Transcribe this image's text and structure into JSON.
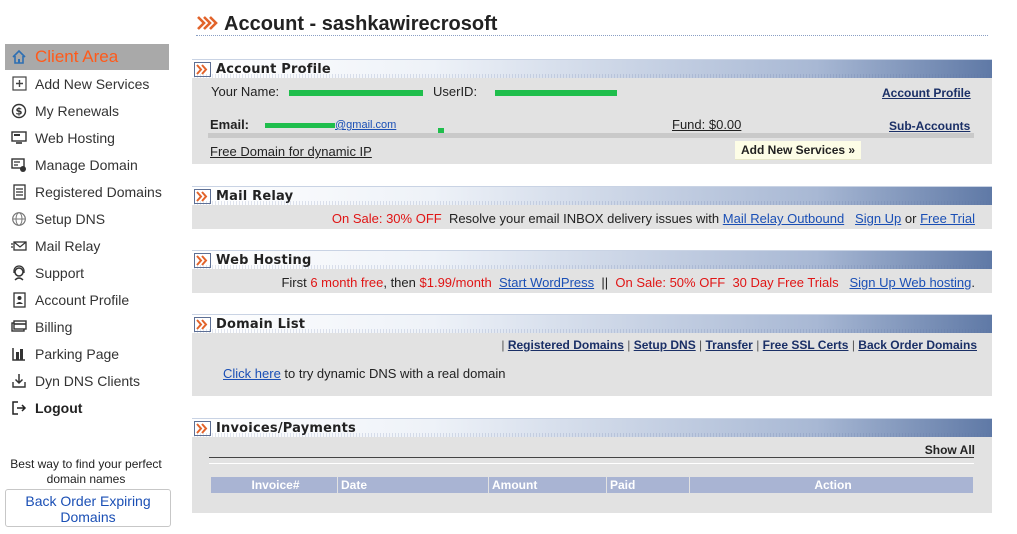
{
  "page": {
    "title": "Account - sashkawirecrosoft"
  },
  "sidebar": {
    "items": [
      {
        "label": "Client Area",
        "icon": "home-icon"
      },
      {
        "label": "Add New Services",
        "icon": "plus-box-icon"
      },
      {
        "label": "My Renewals",
        "icon": "dollar-circle-icon"
      },
      {
        "label": "Web Hosting",
        "icon": "server-icon"
      },
      {
        "label": "Manage Domain",
        "icon": "domain-icon"
      },
      {
        "label": "Registered Domains",
        "icon": "list-icon"
      },
      {
        "label": "Setup DNS",
        "icon": "globe-icon"
      },
      {
        "label": "Mail Relay",
        "icon": "mail-icon"
      },
      {
        "label": "Support",
        "icon": "headset-icon"
      },
      {
        "label": "Account Profile",
        "icon": "profile-icon"
      },
      {
        "label": "Billing",
        "icon": "billing-icon"
      },
      {
        "label": "Parking Page",
        "icon": "parking-icon"
      },
      {
        "label": "Dyn DNS Clients",
        "icon": "download-icon"
      },
      {
        "label": "Logout",
        "icon": "logout-icon"
      }
    ],
    "promo_text": "Best way to find your perfect domain names",
    "promo_button": "Back Order Expiring Domains"
  },
  "account_profile": {
    "title": "Account Profile",
    "your_name_label": "Your Name:",
    "userid_label": "UserID:",
    "email_label": "Email:",
    "email_value": "@gmail.com",
    "fund": "Fund: $0.00",
    "account_profile_link": "Account Profile",
    "sub_accounts_link": "Sub-Accounts",
    "free_domain_link": "Free Domain for dynamic IP",
    "add_services_button": "Add New Services »"
  },
  "mail_relay": {
    "title": "Mail Relay",
    "sale": "On Sale: 30% OFF",
    "text": "Resolve your email INBOX delivery issues with",
    "outbound_link": "Mail Relay Outbound",
    "signup_link": "Sign Up",
    "or": "or",
    "trial_link": "Free Trial"
  },
  "web_hosting": {
    "title": "Web Hosting",
    "first": "First",
    "free": "6 month free",
    "then": ", then",
    "price": "$1.99/month",
    "wordpress_link": "Start WordPress",
    "sep": "||",
    "sale": "On Sale: 50% OFF",
    "trials": "30 Day Free Trials",
    "signup_link": "Sign Up Web hosting",
    "dot": "."
  },
  "domain_list": {
    "title": "Domain List",
    "links": [
      "Registered Domains",
      "Setup DNS",
      "Transfer",
      "Free SSL Certs",
      "Back Order Domains"
    ],
    "click_here": "Click here",
    "dns_text": "to try dynamic DNS with a real domain"
  },
  "invoices": {
    "title": "Invoices/Payments",
    "show_all": "Show All",
    "columns": [
      "Invoice#",
      "Date",
      "Amount",
      "Paid",
      "Action"
    ]
  },
  "colors": {
    "accent": "#ff5a1a",
    "link": "#1a4fb5",
    "sale_red": "#e01515",
    "mask_green": "#1fbe4c",
    "table_header": "#a9b4d3"
  }
}
